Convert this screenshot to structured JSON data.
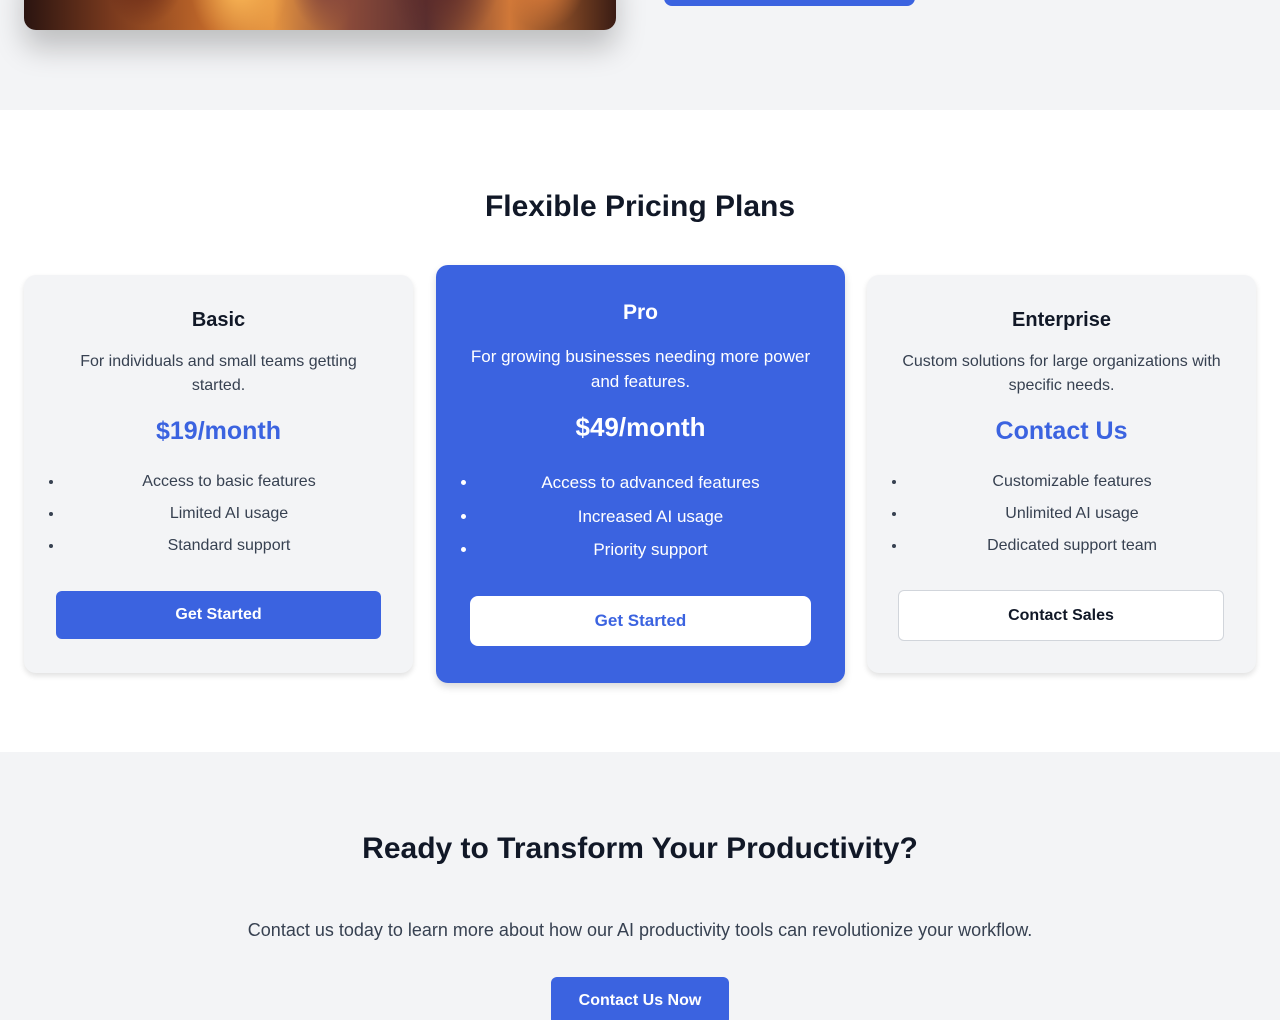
{
  "pricing": {
    "title": "Flexible Pricing Plans",
    "plans": [
      {
        "name": "Basic",
        "description": "For individuals and small teams getting started.",
        "price": "$19/month",
        "features": [
          "Access to basic features",
          "Limited AI usage",
          "Standard support"
        ],
        "button_label": "Get Started"
      },
      {
        "name": "Pro",
        "description": "For growing businesses needing more power and features.",
        "price": "$49/month",
        "features": [
          "Access to advanced features",
          "Increased AI usage",
          "Priority support"
        ],
        "button_label": "Get Started"
      },
      {
        "name": "Enterprise",
        "description": "Custom solutions for large organizations with specific needs.",
        "price": "Contact Us",
        "features": [
          "Customizable features",
          "Unlimited AI usage",
          "Dedicated support team"
        ],
        "button_label": "Contact Sales"
      }
    ]
  },
  "cta": {
    "title": "Ready to Transform Your Productivity?",
    "text": "Contact us today to learn more about how our AI productivity tools can revolutionize your workflow.",
    "button_label": "Contact Us Now"
  },
  "colors": {
    "accent": "#3b63e0",
    "section_bg": "#f3f4f6",
    "heading": "#111827",
    "body_text": "#374151"
  }
}
